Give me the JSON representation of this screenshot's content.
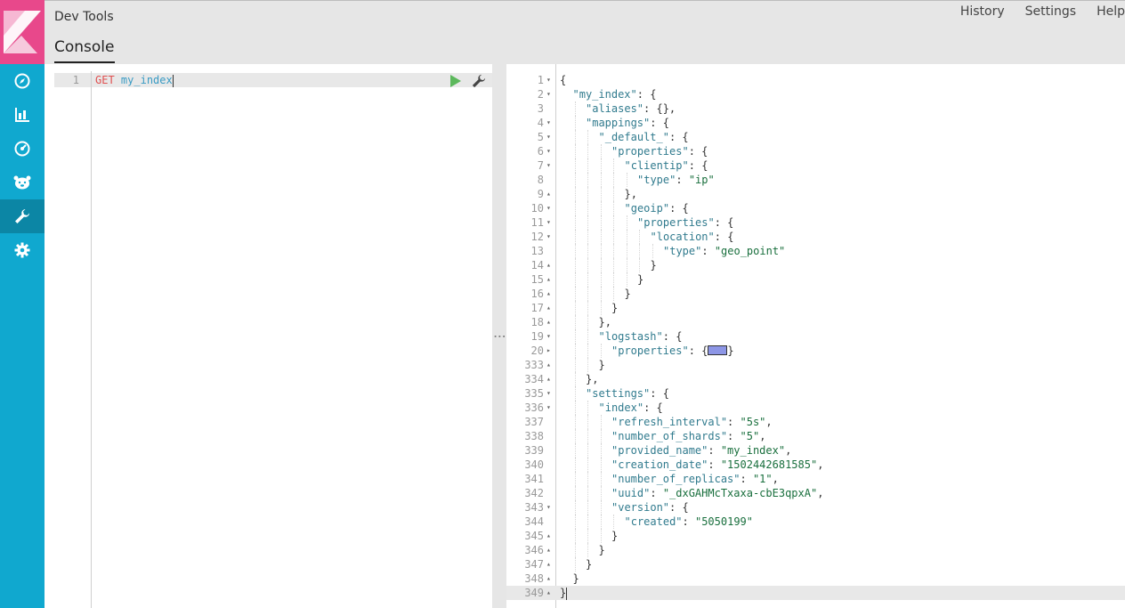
{
  "app": {
    "title": "Dev Tools",
    "tab": "Console"
  },
  "top_links": [
    "History",
    "Settings",
    "Help"
  ],
  "sidebar": {
    "items": [
      {
        "icon": "discover-compass-icon"
      },
      {
        "icon": "visualize-bar-chart-icon"
      },
      {
        "icon": "dashboard-gauge-icon"
      },
      {
        "icon": "timelion-bear-icon"
      },
      {
        "icon": "dev-tools-wrench-icon",
        "active": true
      },
      {
        "icon": "management-gear-icon"
      }
    ],
    "colors": {
      "bg": "#10a8cf",
      "logo": "#e8488b",
      "active": "#0c86a5"
    }
  },
  "editor": {
    "line_number": "1",
    "method": "GET",
    "path": "my_index"
  },
  "output": {
    "lines": [
      {
        "n": "1",
        "fold": "▾",
        "indent": 0,
        "parts": [
          [
            "p",
            "{"
          ]
        ]
      },
      {
        "n": "2",
        "fold": "▾",
        "indent": 1,
        "parts": [
          [
            "k",
            "\"my_index\""
          ],
          [
            "p",
            ": {"
          ]
        ]
      },
      {
        "n": "3",
        "fold": "",
        "indent": 2,
        "parts": [
          [
            "k",
            "\"aliases\""
          ],
          [
            "p",
            ": {},"
          ]
        ]
      },
      {
        "n": "4",
        "fold": "▾",
        "indent": 2,
        "parts": [
          [
            "k",
            "\"mappings\""
          ],
          [
            "p",
            ": {"
          ]
        ]
      },
      {
        "n": "5",
        "fold": "▾",
        "indent": 3,
        "parts": [
          [
            "k",
            "\"_default_\""
          ],
          [
            "p",
            ": {"
          ]
        ]
      },
      {
        "n": "6",
        "fold": "▾",
        "indent": 4,
        "parts": [
          [
            "k",
            "\"properties\""
          ],
          [
            "p",
            ": {"
          ]
        ]
      },
      {
        "n": "7",
        "fold": "▾",
        "indent": 5,
        "parts": [
          [
            "k",
            "\"clientip\""
          ],
          [
            "p",
            ": {"
          ]
        ]
      },
      {
        "n": "8",
        "fold": "",
        "indent": 6,
        "parts": [
          [
            "k",
            "\"type\""
          ],
          [
            "p",
            ": "
          ],
          [
            "s",
            "\"ip\""
          ]
        ]
      },
      {
        "n": "9",
        "fold": "▴",
        "indent": 5,
        "parts": [
          [
            "p",
            "},"
          ]
        ]
      },
      {
        "n": "10",
        "fold": "▾",
        "indent": 5,
        "parts": [
          [
            "k",
            "\"geoip\""
          ],
          [
            "p",
            ": {"
          ]
        ]
      },
      {
        "n": "11",
        "fold": "▾",
        "indent": 6,
        "parts": [
          [
            "k",
            "\"properties\""
          ],
          [
            "p",
            ": {"
          ]
        ]
      },
      {
        "n": "12",
        "fold": "▾",
        "indent": 7,
        "parts": [
          [
            "k",
            "\"location\""
          ],
          [
            "p",
            ": {"
          ]
        ]
      },
      {
        "n": "13",
        "fold": "",
        "indent": 8,
        "parts": [
          [
            "k",
            "\"type\""
          ],
          [
            "p",
            ": "
          ],
          [
            "s",
            "\"geo_point\""
          ]
        ]
      },
      {
        "n": "14",
        "fold": "▴",
        "indent": 7,
        "parts": [
          [
            "p",
            "}"
          ]
        ]
      },
      {
        "n": "15",
        "fold": "▴",
        "indent": 6,
        "parts": [
          [
            "p",
            "}"
          ]
        ]
      },
      {
        "n": "16",
        "fold": "▴",
        "indent": 5,
        "parts": [
          [
            "p",
            "}"
          ]
        ]
      },
      {
        "n": "17",
        "fold": "▴",
        "indent": 4,
        "parts": [
          [
            "p",
            "}"
          ]
        ]
      },
      {
        "n": "18",
        "fold": "▴",
        "indent": 3,
        "parts": [
          [
            "p",
            "},"
          ]
        ]
      },
      {
        "n": "19",
        "fold": "▾",
        "indent": 3,
        "parts": [
          [
            "k",
            "\"logstash\""
          ],
          [
            "p",
            ": {"
          ]
        ]
      },
      {
        "n": "20",
        "fold": "▸",
        "indent": 4,
        "parts": [
          [
            "k",
            "\"properties\""
          ],
          [
            "p",
            ": {"
          ],
          [
            "c",
            ""
          ],
          [
            "p",
            "}"
          ]
        ]
      },
      {
        "n": "333",
        "fold": "▴",
        "indent": 3,
        "parts": [
          [
            "p",
            "}"
          ]
        ]
      },
      {
        "n": "334",
        "fold": "▴",
        "indent": 2,
        "parts": [
          [
            "p",
            "},"
          ]
        ]
      },
      {
        "n": "335",
        "fold": "▾",
        "indent": 2,
        "parts": [
          [
            "k",
            "\"settings\""
          ],
          [
            "p",
            ": {"
          ]
        ]
      },
      {
        "n": "336",
        "fold": "▾",
        "indent": 3,
        "parts": [
          [
            "k",
            "\"index\""
          ],
          [
            "p",
            ": {"
          ]
        ]
      },
      {
        "n": "337",
        "fold": "",
        "indent": 4,
        "parts": [
          [
            "k",
            "\"refresh_interval\""
          ],
          [
            "p",
            ": "
          ],
          [
            "s",
            "\"5s\""
          ],
          [
            "p",
            ","
          ]
        ]
      },
      {
        "n": "338",
        "fold": "",
        "indent": 4,
        "parts": [
          [
            "k",
            "\"number_of_shards\""
          ],
          [
            "p",
            ": "
          ],
          [
            "s",
            "\"5\""
          ],
          [
            "p",
            ","
          ]
        ]
      },
      {
        "n": "339",
        "fold": "",
        "indent": 4,
        "parts": [
          [
            "k",
            "\"provided_name\""
          ],
          [
            "p",
            ": "
          ],
          [
            "s",
            "\"my_index\""
          ],
          [
            "p",
            ","
          ]
        ]
      },
      {
        "n": "340",
        "fold": "",
        "indent": 4,
        "parts": [
          [
            "k",
            "\"creation_date\""
          ],
          [
            "p",
            ": "
          ],
          [
            "s",
            "\"1502442681585\""
          ],
          [
            "p",
            ","
          ]
        ]
      },
      {
        "n": "341",
        "fold": "",
        "indent": 4,
        "parts": [
          [
            "k",
            "\"number_of_replicas\""
          ],
          [
            "p",
            ": "
          ],
          [
            "s",
            "\"1\""
          ],
          [
            "p",
            ","
          ]
        ]
      },
      {
        "n": "342",
        "fold": "",
        "indent": 4,
        "parts": [
          [
            "k",
            "\"uuid\""
          ],
          [
            "p",
            ": "
          ],
          [
            "s",
            "\"_dxGAHMcTxaxa-cbE3qpxA\""
          ],
          [
            "p",
            ","
          ]
        ]
      },
      {
        "n": "343",
        "fold": "▾",
        "indent": 4,
        "parts": [
          [
            "k",
            "\"version\""
          ],
          [
            "p",
            ": {"
          ]
        ]
      },
      {
        "n": "344",
        "fold": "",
        "indent": 5,
        "parts": [
          [
            "k",
            "\"created\""
          ],
          [
            "p",
            ": "
          ],
          [
            "s",
            "\"5050199\""
          ]
        ]
      },
      {
        "n": "345",
        "fold": "▴",
        "indent": 4,
        "parts": [
          [
            "p",
            "}"
          ]
        ]
      },
      {
        "n": "346",
        "fold": "▴",
        "indent": 3,
        "parts": [
          [
            "p",
            "}"
          ]
        ]
      },
      {
        "n": "347",
        "fold": "▴",
        "indent": 2,
        "parts": [
          [
            "p",
            "}"
          ]
        ]
      },
      {
        "n": "348",
        "fold": "▴",
        "indent": 1,
        "parts": [
          [
            "p",
            "}"
          ]
        ]
      },
      {
        "n": "349",
        "fold": "▴",
        "indent": 0,
        "parts": [
          [
            "p",
            "}"
          ]
        ],
        "highlight": true
      }
    ]
  }
}
